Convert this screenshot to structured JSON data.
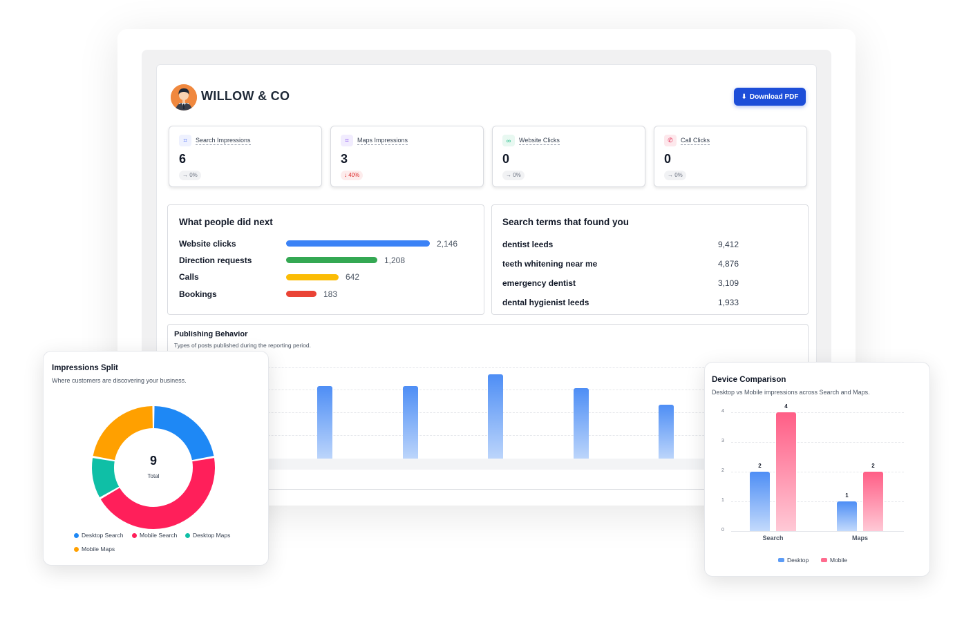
{
  "header": {
    "brand": "WILLOW & CO",
    "download_label": "Download PDF"
  },
  "metrics": [
    {
      "label": "Search Impressions",
      "value": "6",
      "change": "0%",
      "direction": "flat",
      "icon": "search-impressions-icon",
      "color": "#4f6ef7"
    },
    {
      "label": "Maps Impressions",
      "value": "3",
      "change": "40%",
      "direction": "down",
      "icon": "maps-impressions-icon",
      "color": "#7c3aed"
    },
    {
      "label": "Website Clicks",
      "value": "0",
      "change": "0%",
      "direction": "flat",
      "icon": "link-icon",
      "color": "#10b981"
    },
    {
      "label": "Call Clicks",
      "value": "0",
      "change": "0%",
      "direction": "flat",
      "icon": "phone-icon",
      "color": "#e11d48"
    }
  ],
  "actions": {
    "title": "What people did next",
    "rows": [
      {
        "label": "Website clicks",
        "value": "2,146",
        "color": "#3b82f6"
      },
      {
        "label": "Direction requests",
        "value": "1,208",
        "color": "#34a853"
      },
      {
        "label": "Calls",
        "value": "642",
        "color": "#fbbc05"
      },
      {
        "label": "Bookings",
        "value": "183",
        "color": "#ea4335"
      }
    ]
  },
  "terms": {
    "title": "Search terms that found you",
    "rows": [
      {
        "label": "dentist leeds",
        "value": "9,412"
      },
      {
        "label": "teeth whitening near me",
        "value": "4,876"
      },
      {
        "label": "emergency dentist",
        "value": "3,109"
      },
      {
        "label": "dental hygienist leeds",
        "value": "1,933"
      }
    ]
  },
  "publishing": {
    "title": "Publishing Behavior",
    "subtitle": "Types of posts published during the reporting period."
  },
  "impressions_split": {
    "title": "Impressions Split",
    "subtitle": "Where customers are discovering your business.",
    "total": "9",
    "total_label": "Total",
    "legend": [
      "Desktop Search",
      "Mobile Search",
      "Desktop Maps",
      "Mobile Maps"
    ]
  },
  "device_comparison": {
    "title": "Device Comparison",
    "subtitle": "Desktop vs Mobile impressions across Search and Maps.",
    "legend": [
      "Desktop",
      "Mobile"
    ]
  },
  "chart_data": [
    {
      "type": "bar",
      "title": "Publishing Behavior",
      "values": [
        3.1,
        3.1,
        3.6,
        3.0,
        2.3
      ],
      "ylim": [
        0,
        4
      ]
    },
    {
      "type": "pie",
      "title": "Impressions Split",
      "categories": [
        "Desktop Search",
        "Mobile Search",
        "Desktop Maps",
        "Mobile Maps"
      ],
      "values": [
        2,
        4,
        1,
        2
      ],
      "colors": [
        "#1e88f5",
        "#ff1f5a",
        "#0fbfa6",
        "#ffa000"
      ]
    },
    {
      "type": "bar",
      "title": "Device Comparison",
      "categories": [
        "Search",
        "Maps"
      ],
      "series": [
        {
          "name": "Desktop",
          "values": [
            2,
            1
          ]
        },
        {
          "name": "Mobile",
          "values": [
            4,
            2
          ]
        }
      ],
      "yticks": [
        "0",
        "1",
        "2",
        "3",
        "4"
      ],
      "ylim": [
        0,
        4
      ]
    }
  ]
}
